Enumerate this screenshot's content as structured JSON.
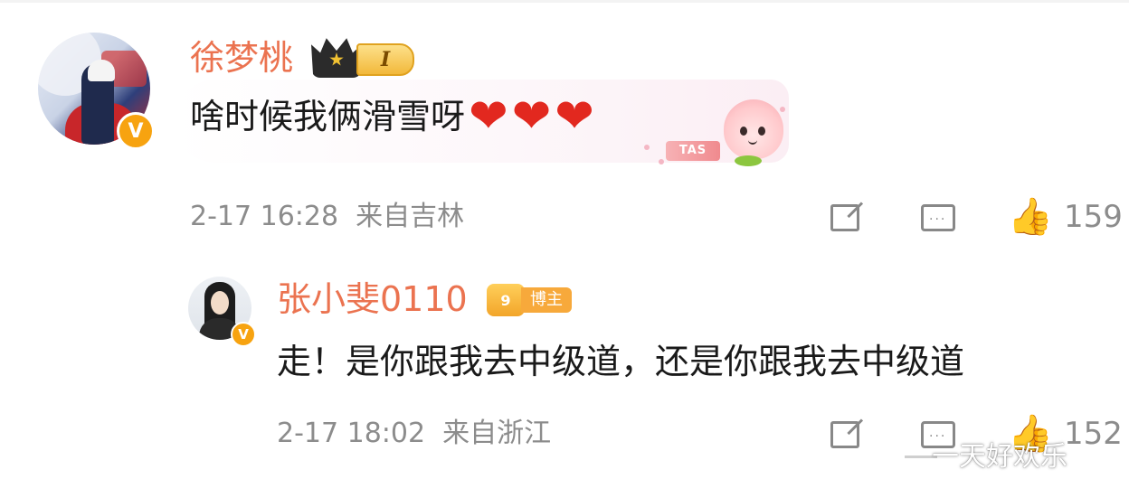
{
  "comment1": {
    "username": "徐梦桃",
    "level_badge": "I",
    "verified_icon": "v-badge-icon",
    "text": "啥时候我俩滑雪呀",
    "hearts": [
      "❤",
      "❤",
      "❤"
    ],
    "sticker_tag": "TAS",
    "time": "2-17 16:28",
    "location": "来自吉林",
    "like_count": "159",
    "icons": [
      "share-icon",
      "comment-icon",
      "like-icon"
    ]
  },
  "reply1": {
    "username": "张小斐0110",
    "role_badge": "博主",
    "role_badge_icon_text": "9",
    "verified_icon": "v-badge-icon",
    "text": "走！是你跟我去中级道，还是你跟我去中级道",
    "time": "2-17 18:02",
    "location": "来自浙江",
    "like_count": "152",
    "icons": [
      "share-icon",
      "comment-icon",
      "like-icon"
    ]
  },
  "watermark": "一天好欢乐",
  "colors": {
    "username": "#eb7350",
    "meta": "#8c8c8c",
    "verified": "#f7a310",
    "heart": "#e2281f"
  }
}
